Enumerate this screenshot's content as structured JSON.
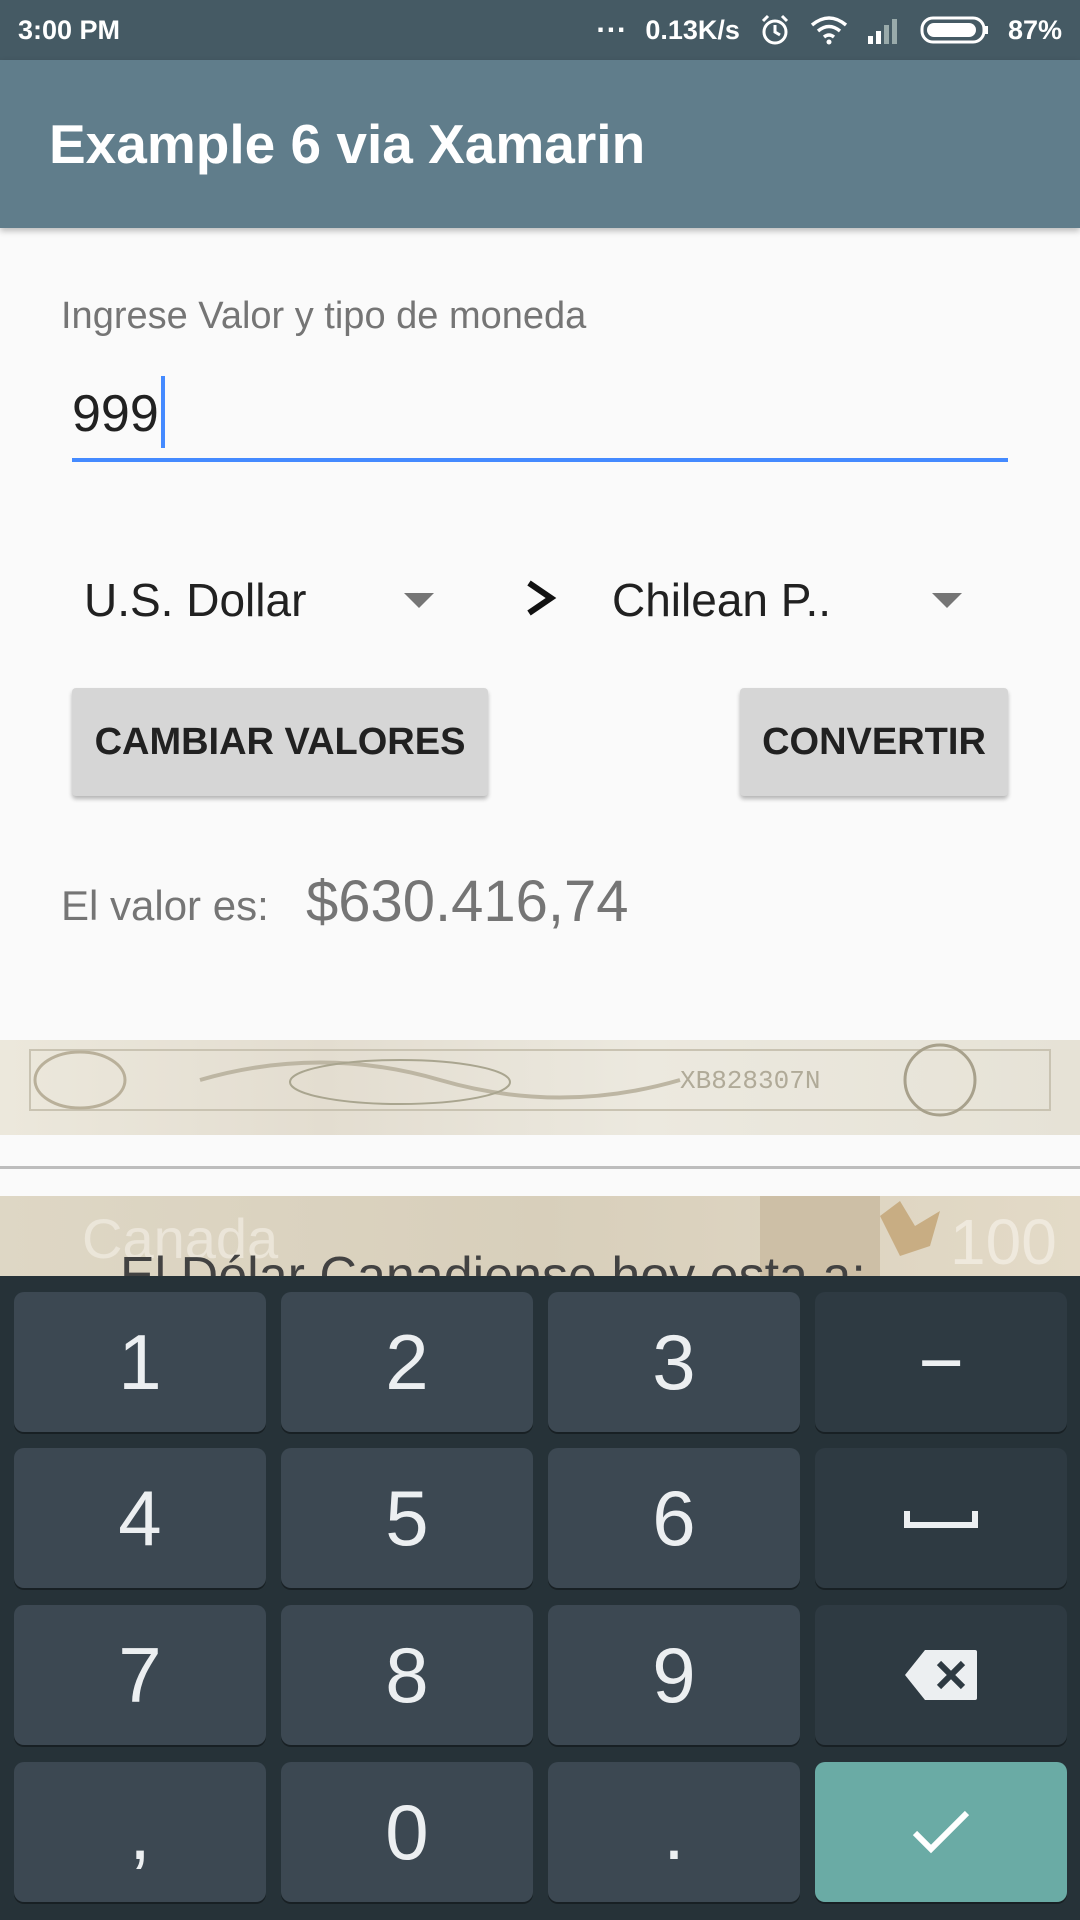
{
  "status_bar": {
    "time": "3:00 PM",
    "dots": "...",
    "speed": "0.13K/s",
    "battery": "87%"
  },
  "app_bar": {
    "title": "Example 6 via Xamarin"
  },
  "form": {
    "label": "Ingrese Valor y tipo de moneda",
    "amount_value": "999",
    "from_currency": "U.S. Dollar",
    "to_currency": "Chilean P..",
    "swap_button": "CAMBIAR VALORES",
    "convert_button": "CONVERTIR",
    "result_label": "El valor es:",
    "result_value": "$630.416,74"
  },
  "banner": {
    "overlay_text": "El Dólar Canadiense hoy esta a:"
  },
  "keyboard": {
    "rows": [
      [
        "1",
        "2",
        "3",
        "−"
      ],
      [
        "4",
        "5",
        "6",
        "␣"
      ],
      [
        "7",
        "8",
        "9",
        "⌫"
      ],
      [
        ",",
        "0",
        ".",
        "✓"
      ]
    ]
  },
  "colors": {
    "status_bar": "#455a64",
    "app_bar": "#607d8b",
    "accent": "#448aff",
    "keyboard_bg": "#263238",
    "enter_key": "#6aaba5"
  }
}
